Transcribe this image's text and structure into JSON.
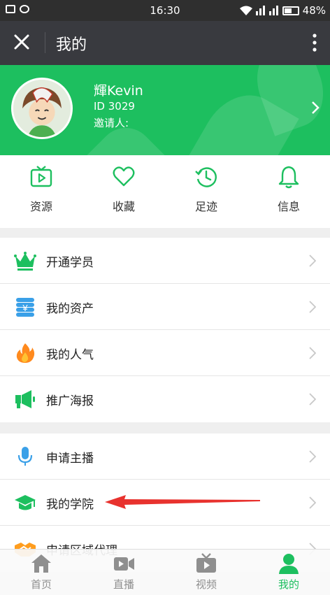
{
  "status_bar": {
    "time": "16:30",
    "battery": "48%"
  },
  "header": {
    "title": "我的"
  },
  "profile": {
    "name": "輝Kevin",
    "id": "ID 3029",
    "invite": "邀请人:"
  },
  "quick_actions": [
    {
      "label": "资源",
      "icon": "tv-play-icon"
    },
    {
      "label": "收藏",
      "icon": "heart-icon"
    },
    {
      "label": "足迹",
      "icon": "history-clock-icon"
    },
    {
      "label": "信息",
      "icon": "bell-icon"
    }
  ],
  "menu_group_1": [
    {
      "label": "开通学员",
      "icon": "crown-icon"
    },
    {
      "label": "我的资产",
      "icon": "coin-stack-icon"
    },
    {
      "label": "我的人气",
      "icon": "flame-icon"
    },
    {
      "label": "推广海报",
      "icon": "megaphone-icon"
    }
  ],
  "menu_group_2": [
    {
      "label": "申请主播",
      "icon": "microphone-icon"
    },
    {
      "label": "我的学院",
      "icon": "graduation-cap-icon"
    },
    {
      "label": "申请区域代理",
      "icon": "handshake-icon"
    }
  ],
  "tabs": [
    {
      "label": "首页",
      "icon": "home-icon"
    },
    {
      "label": "直播",
      "icon": "video-camera-icon"
    },
    {
      "label": "视频",
      "icon": "tv-icon"
    },
    {
      "label": "我的",
      "icon": "person-icon",
      "active": true
    }
  ],
  "colors": {
    "brand_green": "#1dbf5f",
    "title_bar": "#393a3f",
    "annotation_red": "#e8322e"
  }
}
